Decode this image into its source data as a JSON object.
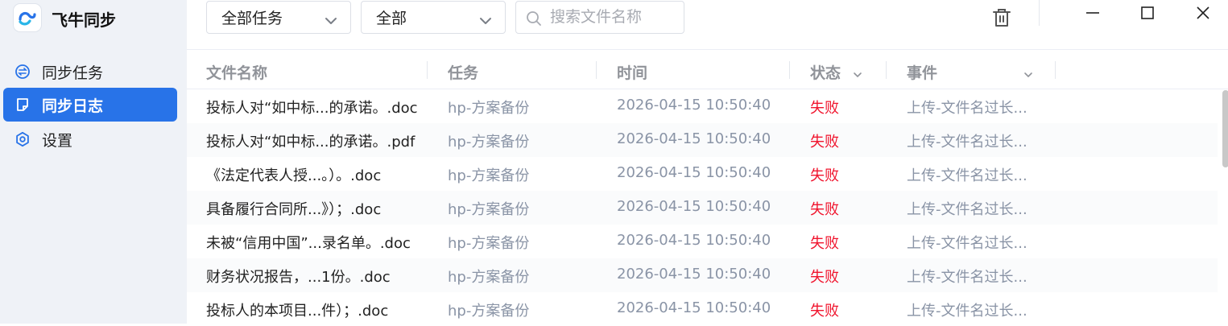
{
  "app": {
    "title": "飞牛同步"
  },
  "sidebar": {
    "items": [
      {
        "label": "同步任务",
        "icon": "sync-icon",
        "active": false
      },
      {
        "label": "同步日志",
        "icon": "log-icon",
        "active": true
      },
      {
        "label": "设置",
        "icon": "gear-icon",
        "active": false
      }
    ]
  },
  "toolbar": {
    "task_filter": "全部任务",
    "status_filter": "全部",
    "search_placeholder": "搜索文件名称",
    "search_value": ""
  },
  "table": {
    "columns": [
      "文件名称",
      "任务",
      "时间",
      "状态",
      "事件"
    ],
    "rows": [
      {
        "name": "投标人对“如中标...的承诺。.doc",
        "task": "hp-方案备份",
        "time": "2026-04-15 10:50:40",
        "status": "失败",
        "event": "上传-文件名过长..."
      },
      {
        "name": "投标人对“如中标...的承诺。.pdf",
        "task": "hp-方案备份",
        "time": "2026-04-15 10:50:40",
        "status": "失败",
        "event": "上传-文件名过长..."
      },
      {
        "name": "《法定代表人授...。）。.doc",
        "task": "hp-方案备份",
        "time": "2026-04-15 10:50:40",
        "status": "失败",
        "event": "上传-文件名过长..."
      },
      {
        "name": "具备履行合同所...》）；.doc",
        "task": "hp-方案备份",
        "time": "2026-04-15 10:50:40",
        "status": "失败",
        "event": "上传-文件名过长..."
      },
      {
        "name": "未被“信用中国”...录名单。.doc",
        "task": "hp-方案备份",
        "time": "2026-04-15 10:50:40",
        "status": "失败",
        "event": "上传-文件名过长..."
      },
      {
        "name": "财务状况报告，...1份。.doc",
        "task": "hp-方案备份",
        "time": "2026-04-15 10:50:40",
        "status": "失败",
        "event": "上传-文件名过长..."
      },
      {
        "name": "投标人的本项目...件）；.doc",
        "task": "hp-方案备份",
        "time": "2026-04-15 10:50:40",
        "status": "失败",
        "event": "上传-文件名过长..."
      }
    ]
  },
  "colors": {
    "accent": "#2873e8",
    "sidebar_bg": "#eff2f7",
    "fail": "#f0142d",
    "muted": "#8a94a6"
  }
}
